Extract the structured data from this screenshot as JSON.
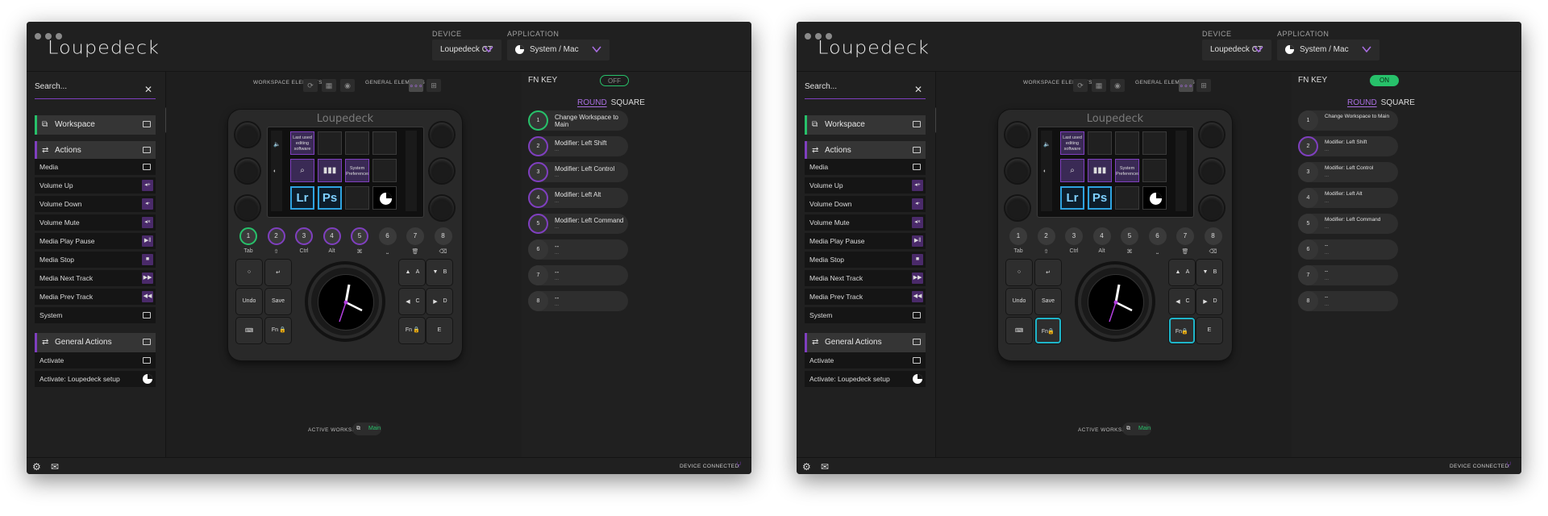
{
  "app": {
    "logo": "Loupedeck",
    "device_label": "DEVICE",
    "device_value": "Loupedeck CT",
    "application_label": "APPLICATION",
    "application_value": "System / Mac",
    "accent": "#7f3fbf",
    "success": "#27c16a"
  },
  "sidebar": {
    "search_placeholder": "Search...",
    "groups": {
      "workspace": "Workspace",
      "actions": "Actions",
      "general_actions": "General Actions"
    },
    "action_items": [
      {
        "label": "Media",
        "icon": "folder-icon"
      },
      {
        "label": "Volume Up",
        "icon": "volume-up-icon"
      },
      {
        "label": "Volume Down",
        "icon": "volume-down-icon"
      },
      {
        "label": "Volume Mute",
        "icon": "volume-mute-icon"
      },
      {
        "label": "Media Play Pause",
        "icon": "play-pause-icon"
      },
      {
        "label": "Media Stop",
        "icon": "stop-icon"
      },
      {
        "label": "Media Next Track",
        "icon": "next-track-icon"
      },
      {
        "label": "Media Prev Track",
        "icon": "prev-track-icon"
      },
      {
        "label": "System",
        "icon": "folder-icon"
      }
    ],
    "general_items": [
      {
        "label": "Activate",
        "icon": "folder-icon"
      },
      {
        "label": "Activate: Loupedeck setup",
        "icon": "loupedeck-icon"
      }
    ]
  },
  "main": {
    "workspace_elements": "WORKSPACE ELEMENTS",
    "general_elements": "GENERAL ELEMENTS",
    "device_logo": "Loupedeck",
    "tiles": {
      "last_used": "Last used editing software",
      "system_prefs": "System Preferences",
      "lr": "Lr",
      "ps": "Ps"
    },
    "number_buttons": [
      "1",
      "2",
      "3",
      "4",
      "5",
      "6",
      "7",
      "8"
    ],
    "number_labels": [
      "Tab",
      "⇧",
      "Ctrl",
      "Alt",
      "⌘",
      "⎵",
      "🗑",
      "⌫"
    ],
    "keys": {
      "circle": "○",
      "enter": "↵",
      "undo": "Undo",
      "save": "Save",
      "keyboard": "⌨",
      "fn": "Fn",
      "up_a": "A",
      "down_b": "B",
      "left_c": "C",
      "right_d": "D",
      "fn2": "Fn",
      "e": "E"
    },
    "active_workspace_label": "ACTIVE WORKSPACE",
    "active_workspace_value": "Main"
  },
  "right": {
    "fn_key_label": "FN KEY",
    "toggle_off": "OFF",
    "toggle_on": "ON",
    "shape_round": "ROUND",
    "shape_square": "SQUARE",
    "assignments": [
      {
        "num": "1",
        "label": "Change Workspace to Main",
        "sub": ""
      },
      {
        "num": "2",
        "label": "Modifier: Left Shift",
        "sub": "..."
      },
      {
        "num": "3",
        "label": "Modifier: Left Control",
        "sub": "..."
      },
      {
        "num": "4",
        "label": "Modifier: Left Alt",
        "sub": "..."
      },
      {
        "num": "5",
        "label": "Modifier: Left Command",
        "sub": "..."
      },
      {
        "num": "6",
        "label": "--",
        "sub": "..."
      },
      {
        "num": "7",
        "label": "--",
        "sub": "..."
      },
      {
        "num": "8",
        "label": "--",
        "sub": "..."
      }
    ]
  },
  "bottom": {
    "device_connected": "DEVICE CONNECTED"
  }
}
